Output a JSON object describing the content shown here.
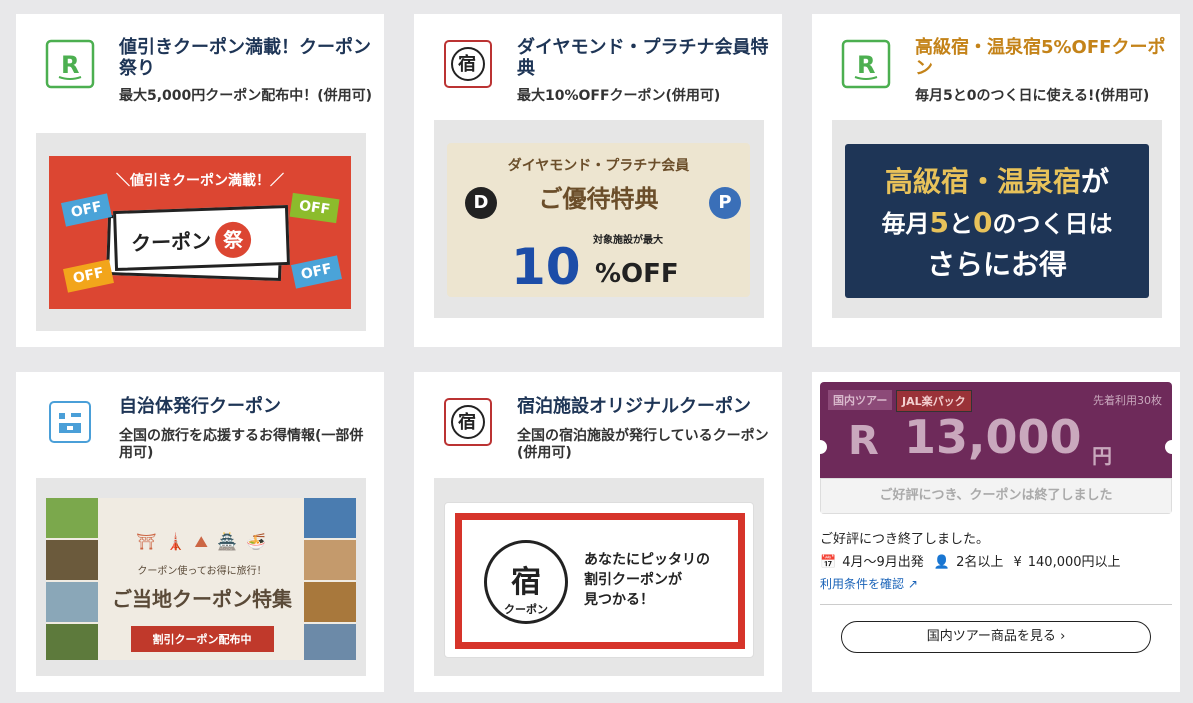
{
  "cards": [
    {
      "title": "値引きクーポン満載！クーポン祭り",
      "subtitle": "最大5,000円クーポン配布中！(併用可)",
      "icon": "rakuten-r-icon",
      "banner": {
        "headline": "＼値引きクーポン満載！／",
        "main_text": "クーポン",
        "main_kanji": "祭",
        "off_labels": [
          "OFF",
          "OFF",
          "OFF",
          "OFF"
        ]
      }
    },
    {
      "title": "ダイヤモンド・プラチナ会員特典",
      "subtitle": "最大10%OFFクーポン(併用可)",
      "icon": "yado-coupon-icon",
      "banner": {
        "headline": "ダイヤモンド・プラチナ会員",
        "main_text": "ご優待特典",
        "small_text": "対象施設が最大",
        "number": "10",
        "suffix": "%OFF",
        "medal_d": "D",
        "medal_p": "P"
      }
    },
    {
      "title": "高級宿・温泉宿5%OFFクーポン",
      "subtitle": "毎月5と0のつく日に使える!(併用可)",
      "icon": "rakuten-r-icon",
      "banner": {
        "line1_a": "高級宿・温泉宿",
        "line1_b": "が",
        "line2_a": "毎月",
        "line2_b": "5",
        "line2_c": "と",
        "line2_d": "0",
        "line2_e": "のつく日は",
        "line3": "さらにお得"
      }
    },
    {
      "title": "自治体発行クーポン",
      "subtitle": "全国の旅行を応援するお得情報(一部併用可)",
      "icon": "municipality-icon",
      "banner": {
        "tagline": "クーポン使ってお得に旅行！",
        "main_text": "ご当地クーポン特集",
        "button": "割引クーポン配布中"
      }
    },
    {
      "title": "宿泊施設オリジナルクーポン",
      "subtitle": "全国の宿泊施設が発行しているクーポン(併用可)",
      "icon": "yado-coupon-icon",
      "banner": {
        "yado": "宿",
        "coupon": "クーポン",
        "line1": "あなたにピッタリの",
        "line2": "割引クーポンが",
        "line3": "見つかる！"
      }
    }
  ],
  "tour": {
    "tag1": "国内ツアー",
    "tag2": "JAL楽パック",
    "limit": "先着利用30枚",
    "r_mark": "R",
    "amount": "13,000",
    "yen": "円",
    "ended_banner": "ご好評につき、クーポンは終了しました",
    "ended_text": "ご好評につき終了しました。",
    "period": "4月〜9月出発",
    "people": "2名以上",
    "price": "140,000円以上",
    "terms_link": "利用条件を確認",
    "button": "国内ツアー商品を見る"
  }
}
